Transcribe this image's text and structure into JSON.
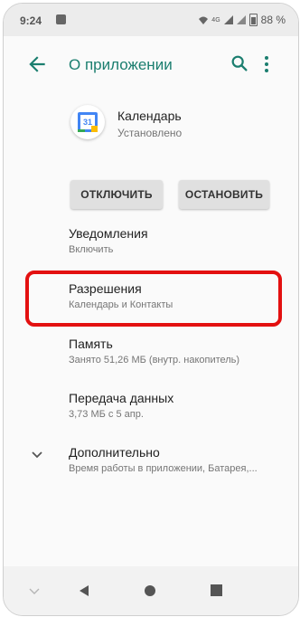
{
  "status_bar": {
    "time": "9:24",
    "network": "4G",
    "battery": "88 %"
  },
  "app_bar": {
    "title": "О приложении",
    "back_icon": "arrow-back-icon",
    "search_icon": "search-icon",
    "more_icon": "more-vert-icon"
  },
  "app": {
    "name": "Календарь",
    "status": "Установлено",
    "icon_day": "31"
  },
  "buttons": {
    "disable_label": "ОТКЛЮЧИТЬ",
    "stop_label": "ОСТАНОВИТЬ"
  },
  "settings": [
    {
      "title": "Уведомления",
      "subtitle": "Включить"
    },
    {
      "title": "Разрешения",
      "subtitle": "Календарь и Контакты"
    },
    {
      "title": "Память",
      "subtitle": "Занято 51,26 МБ (внутр. накопитель)"
    },
    {
      "title": "Передача данных",
      "subtitle": "3,73 МБ с 5 апр."
    },
    {
      "title": "Дополнительно",
      "subtitle": "Время работы в приложении, Батарея,..."
    }
  ],
  "colors": {
    "accent": "#1b7e6f",
    "highlight": "#e31010"
  }
}
